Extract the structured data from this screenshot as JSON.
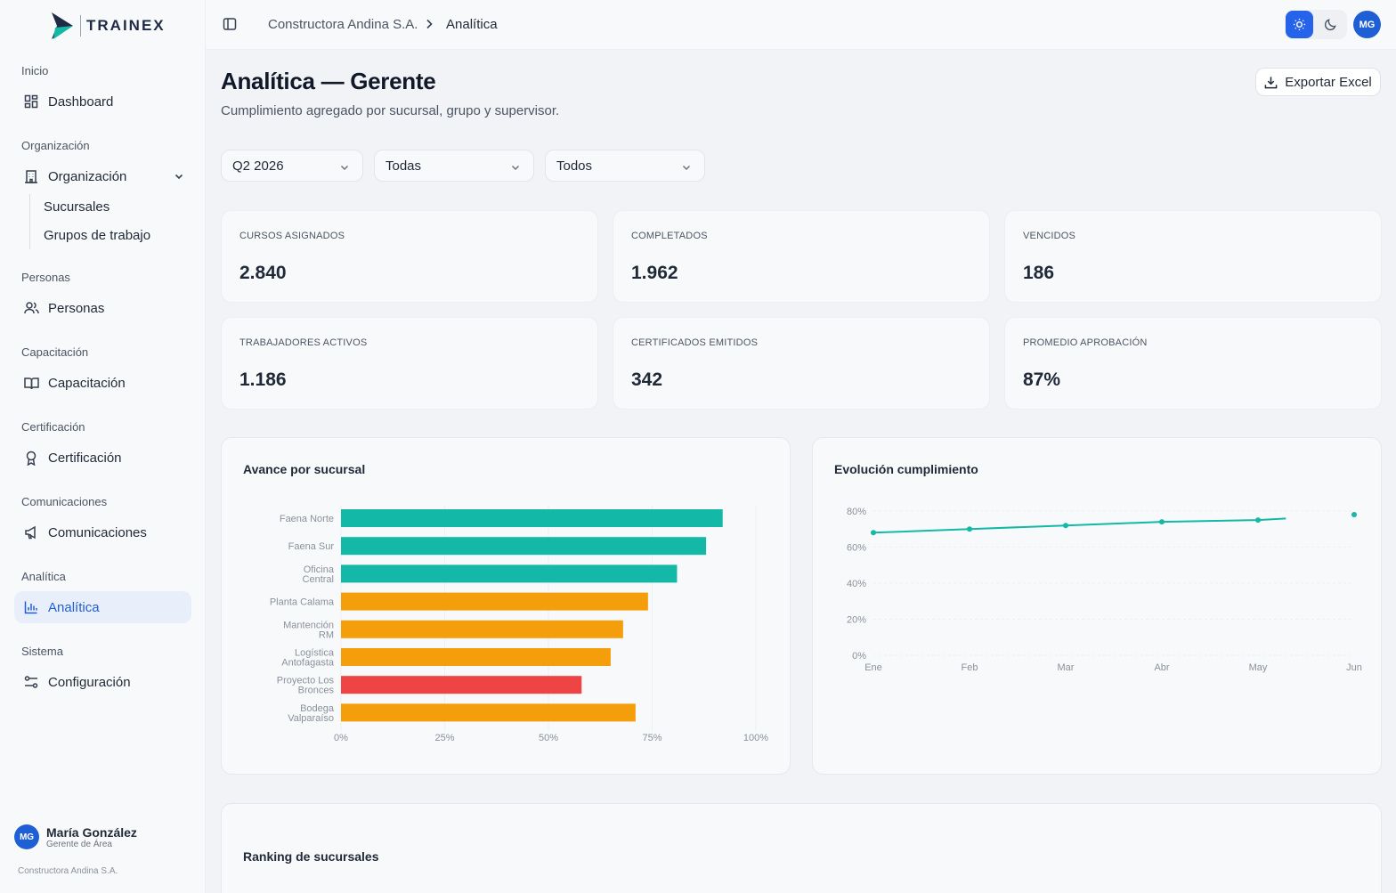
{
  "app": {
    "brand": "TRAINEX"
  },
  "sidebar": {
    "sections": [
      {
        "title": "Inicio",
        "items": [
          {
            "label": "Dashboard",
            "icon": "dashboard-icon"
          }
        ]
      },
      {
        "title": "Organización",
        "items": [
          {
            "label": "Organización",
            "icon": "building-icon",
            "expanded": true,
            "children": [
              "Sucursales",
              "Grupos de trabajo"
            ]
          }
        ]
      },
      {
        "title": "Personas",
        "items": [
          {
            "label": "Personas",
            "icon": "users-icon"
          }
        ]
      },
      {
        "title": "Capacitación",
        "items": [
          {
            "label": "Capacitación",
            "icon": "book-icon"
          }
        ]
      },
      {
        "title": "Certificación",
        "items": [
          {
            "label": "Certificación",
            "icon": "award-icon"
          }
        ]
      },
      {
        "title": "Comunicaciones",
        "items": [
          {
            "label": "Comunicaciones",
            "icon": "megaphone-icon"
          }
        ]
      },
      {
        "title": "Analítica",
        "items": [
          {
            "label": "Analítica",
            "icon": "bar-chart-icon",
            "active": true
          }
        ]
      },
      {
        "title": "Sistema",
        "items": [
          {
            "label": "Configuración",
            "icon": "sliders-icon"
          }
        ]
      }
    ],
    "user": {
      "initials": "MG",
      "name": "María González",
      "role": "Gerente de Área",
      "company": "Constructora Andina S.A."
    }
  },
  "topbar": {
    "breadcrumb": [
      "Constructora Andina S.A.",
      "Analítica"
    ],
    "theme": "light",
    "avatar_initials": "MG"
  },
  "page": {
    "title": "Analítica — Gerente",
    "subtitle": "Cumplimiento agregado por sucursal, grupo y supervisor.",
    "export_label": "Exportar Excel"
  },
  "filters": [
    {
      "value": "Q2 2026"
    },
    {
      "value": "Todas"
    },
    {
      "value": "Todos"
    }
  ],
  "kpis": [
    {
      "label": "CURSOS ASIGNADOS",
      "value": "2.840"
    },
    {
      "label": "COMPLETADOS",
      "value": "1.962"
    },
    {
      "label": "VENCIDOS",
      "value": "186"
    },
    {
      "label": "TRABAJADORES ACTIVOS",
      "value": "1.186"
    },
    {
      "label": "CERTIFICADOS EMITIDOS",
      "value": "342"
    },
    {
      "label": "PROMEDIO APROBACIÓN",
      "value": "87%"
    }
  ],
  "charts": {
    "branch_title": "Avance por sucursal",
    "trend_title": "Evolución cumplimiento",
    "ranking_title": "Ranking de sucursales"
  },
  "chart_data": [
    {
      "type": "bar",
      "orientation": "horizontal",
      "title": "Avance por sucursal",
      "categories": [
        [
          "Faena Norte"
        ],
        [
          "Faena Sur"
        ],
        [
          "Oficina",
          "Central"
        ],
        [
          "Planta Calama"
        ],
        [
          "Mantención",
          "RM"
        ],
        [
          "Logística",
          "Antofagasta"
        ],
        [
          "Proyecto Los",
          "Bronces"
        ],
        [
          "Bodega",
          "Valparaíso"
        ]
      ],
      "values": [
        92,
        88,
        81,
        74,
        68,
        65,
        58,
        71
      ],
      "colors": [
        "#14b8a6",
        "#14b8a6",
        "#14b8a6",
        "#f59e0b",
        "#f59e0b",
        "#f59e0b",
        "#ef4444",
        "#f59e0b"
      ],
      "xlim": [
        0,
        100
      ],
      "xticks": [
        "0%",
        "25%",
        "50%",
        "75%",
        "100%"
      ]
    },
    {
      "type": "line",
      "title": "Evolución cumplimiento",
      "categories": [
        "Ene",
        "Feb",
        "Mar",
        "Abr",
        "May",
        "Jun"
      ],
      "values": [
        68,
        70,
        72,
        74,
        75,
        78
      ],
      "color": "#14b8a6",
      "ylim": [
        0,
        80
      ],
      "yticks": [
        "0%",
        "20%",
        "40%",
        "60%",
        "80%"
      ],
      "grid": true
    }
  ]
}
